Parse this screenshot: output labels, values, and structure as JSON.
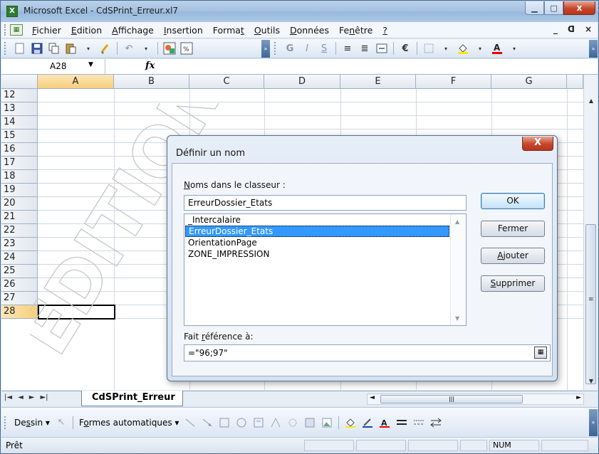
{
  "window": {
    "title": "Microsoft Excel - CdSPrint_Erreur.xl7",
    "controls": {
      "minimize": "▁",
      "maximize": "□",
      "close": "x"
    }
  },
  "menubar": {
    "items": [
      {
        "u": "F",
        "rest": "ichier"
      },
      {
        "u": "E",
        "rest": "dition"
      },
      {
        "u": "A",
        "rest": "ffichage"
      },
      {
        "u": "I",
        "rest": "nsertion"
      },
      {
        "pre": "Forma",
        "u": "t",
        "rest": ""
      },
      {
        "u": "O",
        "rest": "utils"
      },
      {
        "u": "D",
        "rest": "onnées"
      },
      {
        "pre": "Fe",
        "u": "n",
        "rest": "être"
      },
      {
        "u": "?",
        "rest": ""
      }
    ],
    "doc_controls": {
      "minimize": "_",
      "restore": "ᗡ",
      "close": "×"
    }
  },
  "toolbar": {
    "bold": "G",
    "italic": "I",
    "underline": "S",
    "euro": "€"
  },
  "formula_bar": {
    "name_box": "A28",
    "fx": "fx",
    "content": ""
  },
  "grid": {
    "columns": [
      "A",
      "B",
      "C",
      "D",
      "E",
      "F",
      "G"
    ],
    "rows": [
      "12",
      "13",
      "14",
      "15",
      "16",
      "17",
      "18",
      "19",
      "20",
      "21",
      "22",
      "23",
      "24",
      "25",
      "26",
      "27",
      "28"
    ],
    "selected_column": "A",
    "selected_row": "28",
    "watermark": "ÉDITIONS"
  },
  "sheet_tabs": {
    "nav": [
      "|◄",
      "◄",
      "►",
      "►|"
    ],
    "active": "CdSPrint_Erreur"
  },
  "draw_toolbar": {
    "draw": {
      "pre": "De",
      "u": "s",
      "rest": "sin"
    },
    "autoshapes": {
      "pre": "F",
      "u": "o",
      "rest": "rmes automatiques"
    }
  },
  "statusbar": {
    "ready": "Prêt",
    "num": "NUM"
  },
  "dialog": {
    "title": "Définir un nom",
    "close_label": "X",
    "names_label": {
      "pre": "",
      "u": "N",
      "rest": "oms dans le classeur :"
    },
    "name_input": "ErreurDossier_Etats",
    "names": [
      "_Intercalaire",
      "ErreurDossier_Etats",
      "OrientationPage",
      "ZONE_IMPRESSION"
    ],
    "selected_name": "ErreurDossier_Etats",
    "refers_label": {
      "pre": "Fait ",
      "u": "r",
      "rest": "éférence à:"
    },
    "refers_value": "=\"96;97\"",
    "buttons": {
      "ok": "OK",
      "close": "Fermer",
      "add": {
        "u": "A",
        "rest": "jouter"
      },
      "delete": {
        "u": "S",
        "rest": "upprimer"
      }
    }
  },
  "colors": {
    "selection": "#3399ff",
    "header_selected": "#f7cf7a",
    "close_red": "#c7462a"
  }
}
